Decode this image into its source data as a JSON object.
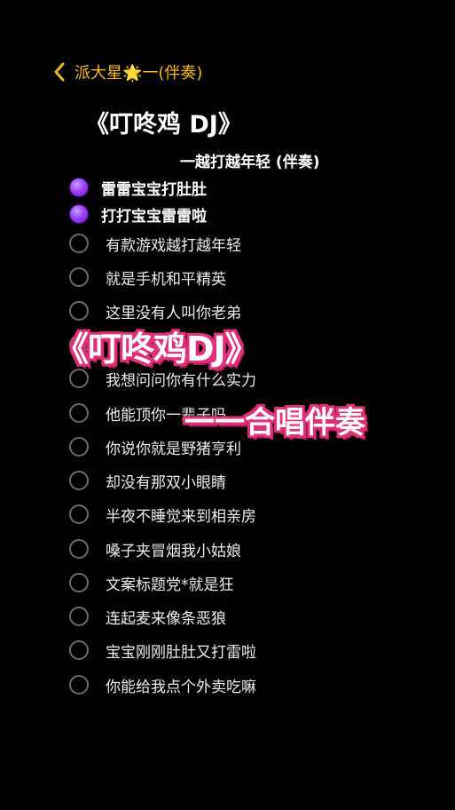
{
  "header": {
    "back_icon": "chevron-left-icon",
    "title": "派大星🌟一(伴奏)"
  },
  "heading": "《叮咚鸡 DJ》",
  "subheading": "一越打越年轻 (伴奏)",
  "checklist": [
    {
      "label": "雷雷宝宝打肚肚",
      "checked": true
    },
    {
      "label": "打打宝宝雷雷啦",
      "checked": true
    },
    {
      "label": "有款游戏越打越年轻",
      "checked": false
    },
    {
      "label": "就是手机和平精英",
      "checked": false
    },
    {
      "label": "这里没有人叫你老弟",
      "checked": false
    },
    {
      "label": "",
      "checked": false
    },
    {
      "label": "我想问问你有什么实力",
      "checked": false
    },
    {
      "label": "他能顶你一辈子吗",
      "checked": false
    },
    {
      "label": "你说你就是野猪亨利",
      "checked": false
    },
    {
      "label": "却没有那双小眼睛",
      "checked": false
    },
    {
      "label": "半夜不睡觉来到相亲房",
      "checked": false
    },
    {
      "label": "嗓子夹冒烟我小姑娘",
      "checked": false
    },
    {
      "label": "文案标题党*就是狂",
      "checked": false
    },
    {
      "label": "连起麦来像条恶狼",
      "checked": false
    },
    {
      "label": "宝宝刚刚肚肚又打雷啦",
      "checked": false
    },
    {
      "label": "你能给我点个外卖吃嘛",
      "checked": false
    }
  ],
  "overlay": {
    "line1": "《叮咚鸡DJ》",
    "line2": "一一合唱伴奏"
  },
  "colors": {
    "background": "#000000",
    "accent": "#f5b920",
    "checked_radio": "#9a3cf5",
    "overlay_outline": "#e0307a"
  }
}
